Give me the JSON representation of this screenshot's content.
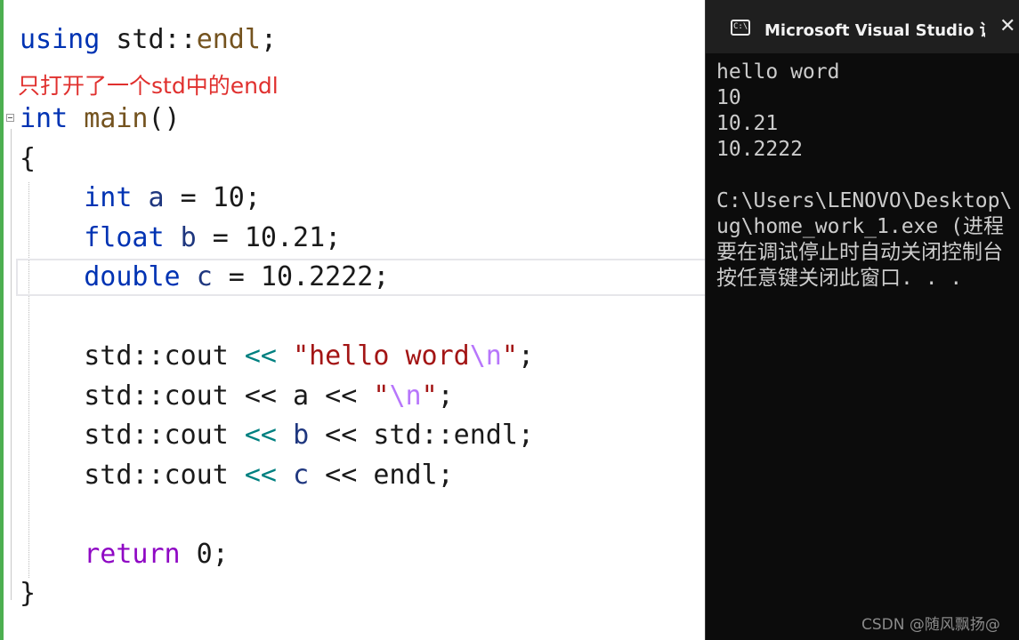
{
  "editor": {
    "using": {
      "kw": "using",
      "rest": " std::",
      "fn": "endl",
      "end": ";"
    },
    "annotation": "只打开了一个std中的endl",
    "main_sig": {
      "kw": "int",
      "sp": " ",
      "fn": "main",
      "end": "()"
    },
    "open_brace": "{",
    "decl_a": {
      "kw": "int",
      "sp": " ",
      "var": "a",
      "rest": " = 10;"
    },
    "decl_b": {
      "kw": "float",
      "sp": " ",
      "var": "b",
      "rest": " = 10.21;"
    },
    "decl_c": {
      "kw": "double",
      "sp": " ",
      "var": "c",
      "rest": " = 10.2222;"
    },
    "cout1": {
      "obj": "std::cout",
      "sp": " ",
      "op": "<<",
      "sp2": " ",
      "str": "\"hello word",
      "esc": "\\n",
      "strend": "\"",
      "end": ";"
    },
    "cout2": {
      "obj": "std::cout",
      "rest": " << a << ",
      "str": "\"",
      "esc": "\\n",
      "strend": "\"",
      "end": ";"
    },
    "cout3": {
      "obj": "std::cout",
      "sp": " ",
      "op": "<<",
      "sp2": " ",
      "var": "b",
      "rest": " << std::endl;"
    },
    "cout4": {
      "obj": "std::cout",
      "sp": " ",
      "op": "<<",
      "sp2": " ",
      "var": "c",
      "rest": " << endl;"
    },
    "ret": {
      "kw": "return",
      "rest": " 0;"
    },
    "close_brace": "}"
  },
  "console": {
    "title": "Microsoft Visual Studio 调试控制台",
    "icon_label": "C:\\",
    "close_glyph": "✕",
    "output": [
      "hello word",
      "10",
      "10.21",
      "10.2222"
    ],
    "path_line1": "C:\\Users\\LENOVO\\Desktop\\",
    "path_line2": "ug\\home_work_1.exe (进程",
    "msg_line1": "要在调试停止时自动关闭控制台",
    "msg_line2": "按任意键关闭此窗口. . ."
  },
  "watermark": "CSDN @随风飘扬@"
}
